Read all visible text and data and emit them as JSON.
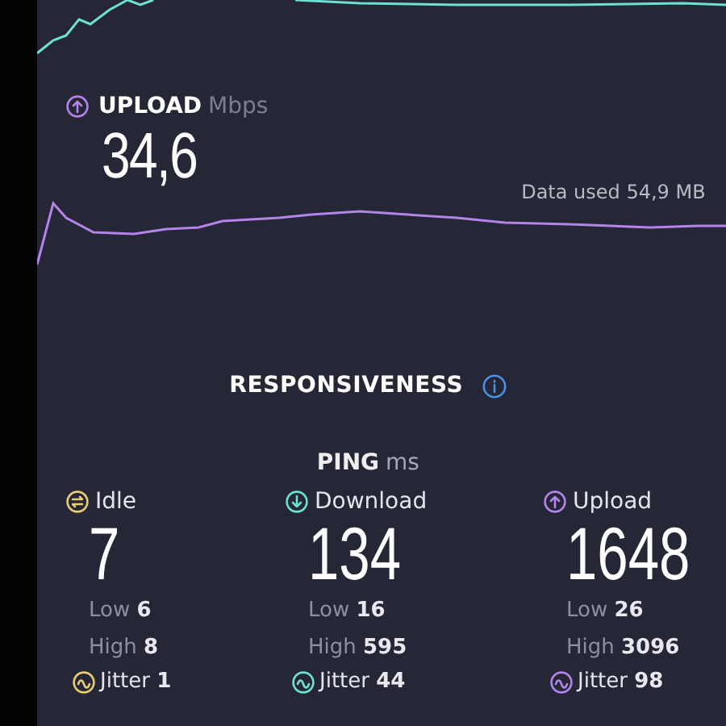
{
  "upload": {
    "label": "UPLOAD",
    "unit": "Mbps",
    "value": "34,6",
    "data_used": "Data used 54,9 MB"
  },
  "responsiveness": {
    "title": "RESPONSIVENESS"
  },
  "ping": {
    "label": "PING",
    "unit": "ms",
    "columns": [
      {
        "kind": "idle",
        "color": "#e6cf73",
        "name": "Idle",
        "value": "7",
        "low": "Low **6**",
        "high": "High **8**",
        "jitter": "Jitter **1**"
      },
      {
        "kind": "download",
        "color": "#6fe0d4",
        "name": "Download",
        "value": "134",
        "low": "Low **16**",
        "high": "High **595**",
        "jitter": "Jitter **44**"
      },
      {
        "kind": "upload",
        "color": "#b384ea",
        "name": "Upload",
        "value": "1648",
        "low": "Low **26**",
        "high": "High **3096**",
        "jitter": "Jitter **98**"
      }
    ]
  }
}
